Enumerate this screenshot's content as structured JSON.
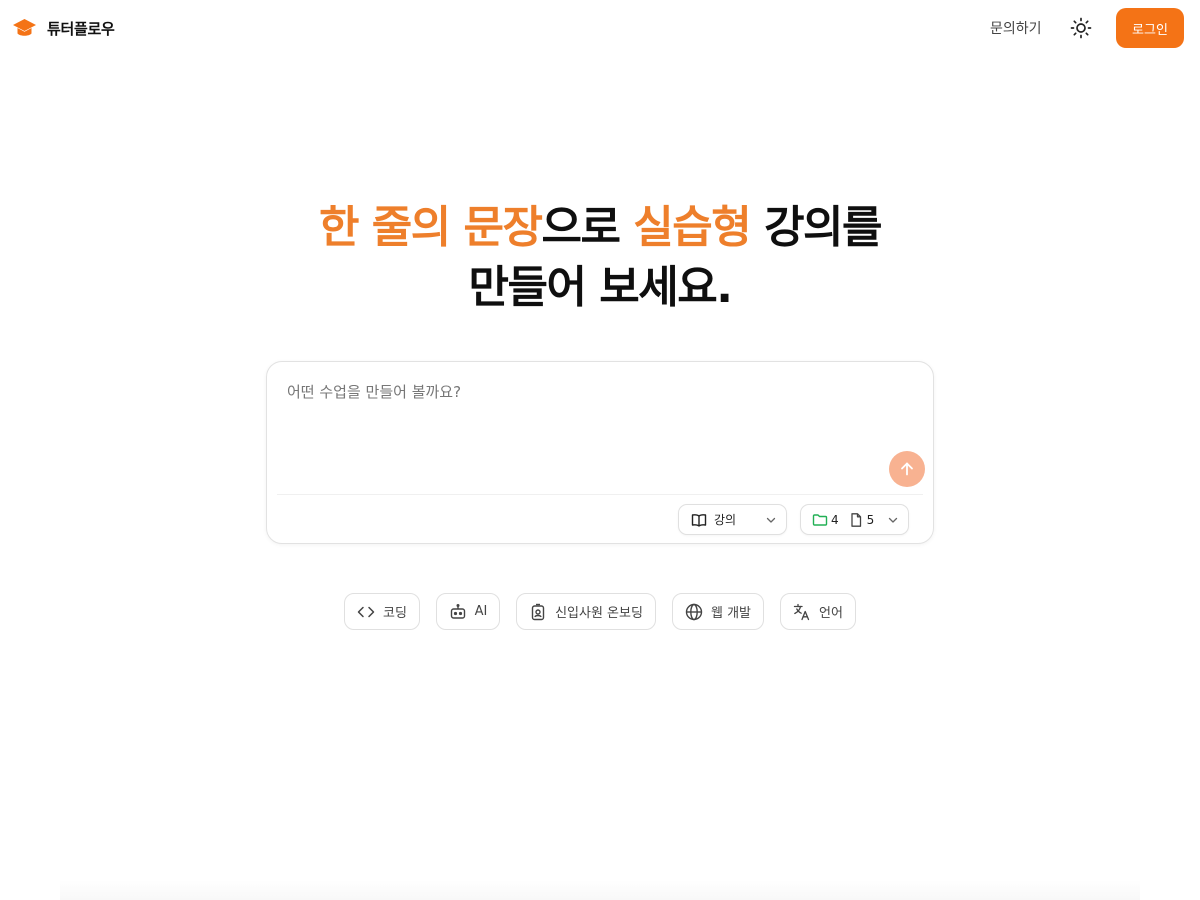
{
  "header": {
    "brand": "튜터플로우",
    "contact_link": "문의하기",
    "login_button": "로그인"
  },
  "hero": {
    "line1_highlight1": "한 줄의 문장",
    "line1_plain1": "으로 ",
    "line1_highlight2": "실습형",
    "line1_plain2": " 강의를",
    "line2": "만들어 보세요."
  },
  "prompt": {
    "placeholder": "어떤 수업을 만들어 볼까요?",
    "value": "",
    "type_select": "강의",
    "folder_count": "4",
    "file_count": "5"
  },
  "suggestions": [
    {
      "label": "코딩",
      "icon": "code-icon"
    },
    {
      "label": "AI",
      "icon": "robot-icon"
    },
    {
      "label": "신입사원 온보딩",
      "icon": "badge-icon"
    },
    {
      "label": "웹 개발",
      "icon": "globe-icon"
    },
    {
      "label": "언어",
      "icon": "translate-icon"
    }
  ],
  "colors": {
    "accent": "#f47316",
    "headline_highlight": "#ee7f2b",
    "send_button": "#f8b291",
    "folder_icon": "#22b055"
  }
}
